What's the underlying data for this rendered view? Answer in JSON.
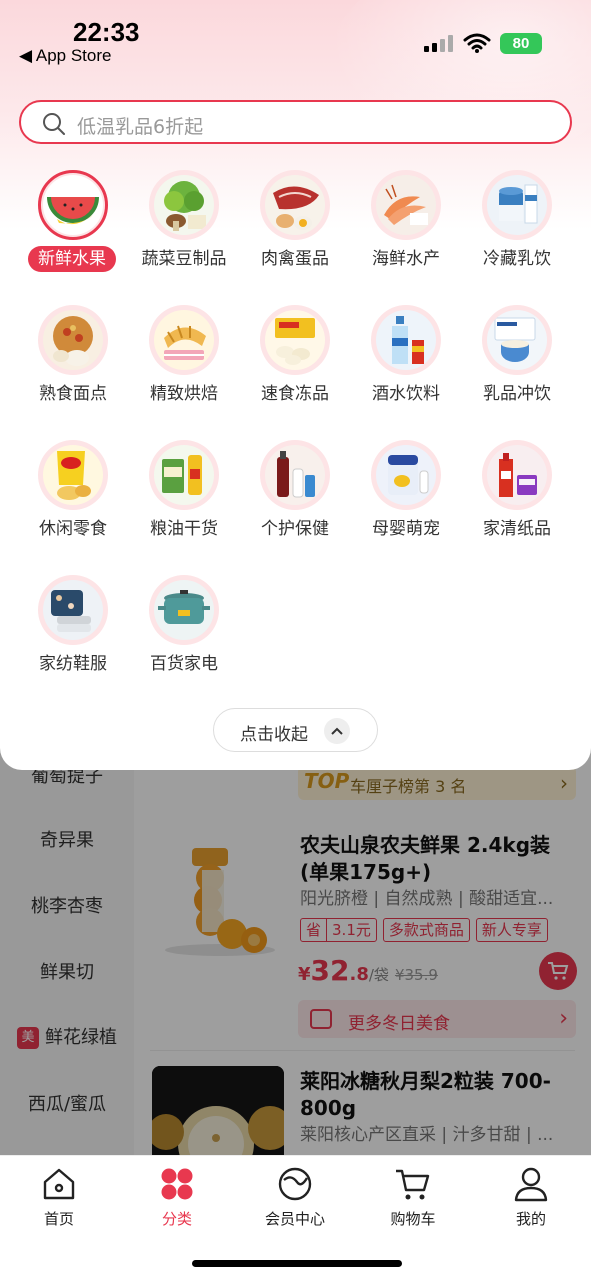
{
  "status_bar": {
    "time": "22:33",
    "back_app": "◀ App Store",
    "battery": "80"
  },
  "search": {
    "placeholder": "低温乳品6折起"
  },
  "categories": [
    {
      "label": "新鲜水果",
      "active": true
    },
    {
      "label": "蔬菜豆制品"
    },
    {
      "label": "肉禽蛋品"
    },
    {
      "label": "海鲜水产"
    },
    {
      "label": "冷藏乳饮"
    },
    {
      "label": "熟食面点"
    },
    {
      "label": "精致烘焙"
    },
    {
      "label": "速食冻品"
    },
    {
      "label": "酒水饮料"
    },
    {
      "label": "乳品冲饮"
    },
    {
      "label": "休闲零食"
    },
    {
      "label": "粮油干货"
    },
    {
      "label": "个护保健"
    },
    {
      "label": "母婴萌宠"
    },
    {
      "label": "家清纸品"
    },
    {
      "label": "家纺鞋服"
    },
    {
      "label": "百货家电"
    }
  ],
  "collapse_label": "点击收起",
  "sidebar": {
    "items": [
      {
        "label": "葡萄提子"
      },
      {
        "label": "奇异果"
      },
      {
        "label": "桃李杏枣"
      },
      {
        "label": "鲜果切"
      },
      {
        "label": "鲜花绿植",
        "badge": "美"
      },
      {
        "label": "西瓜/蜜瓜"
      }
    ]
  },
  "top_rank": {
    "badge": "TOP",
    "text": "车厘子榜第 3 名"
  },
  "product1": {
    "title": "农夫山泉农夫鲜果 2.4kg装(单果175g+)",
    "desc": "阳光脐橙 | 自然成熟 | 酸甜适宜...",
    "tag_save_prefix": "省",
    "tag_save_amount": "3.1元",
    "tag2": "多款式商品",
    "tag3": "新人专享",
    "price_currency": "¥",
    "price_int": "32",
    "price_dec": ".8",
    "price_unit": "/袋",
    "price_orig": "¥35.9"
  },
  "more_bar": {
    "text": "更多冬日美食"
  },
  "product2": {
    "title": "莱阳冰糖秋月梨2粒装 700-800g",
    "desc": "莱阳核心产区直采 | 汁多甘甜 | ..."
  },
  "tabbar": {
    "items": [
      {
        "label": "首页",
        "icon": "home-icon"
      },
      {
        "label": "分类",
        "icon": "category-icon",
        "active": true
      },
      {
        "label": "会员中心",
        "icon": "member-icon"
      },
      {
        "label": "购物车",
        "icon": "cart-icon"
      },
      {
        "label": "我的",
        "icon": "profile-icon"
      }
    ]
  },
  "colors": {
    "accent": "#e8384f",
    "gold": "#d89a1e"
  }
}
